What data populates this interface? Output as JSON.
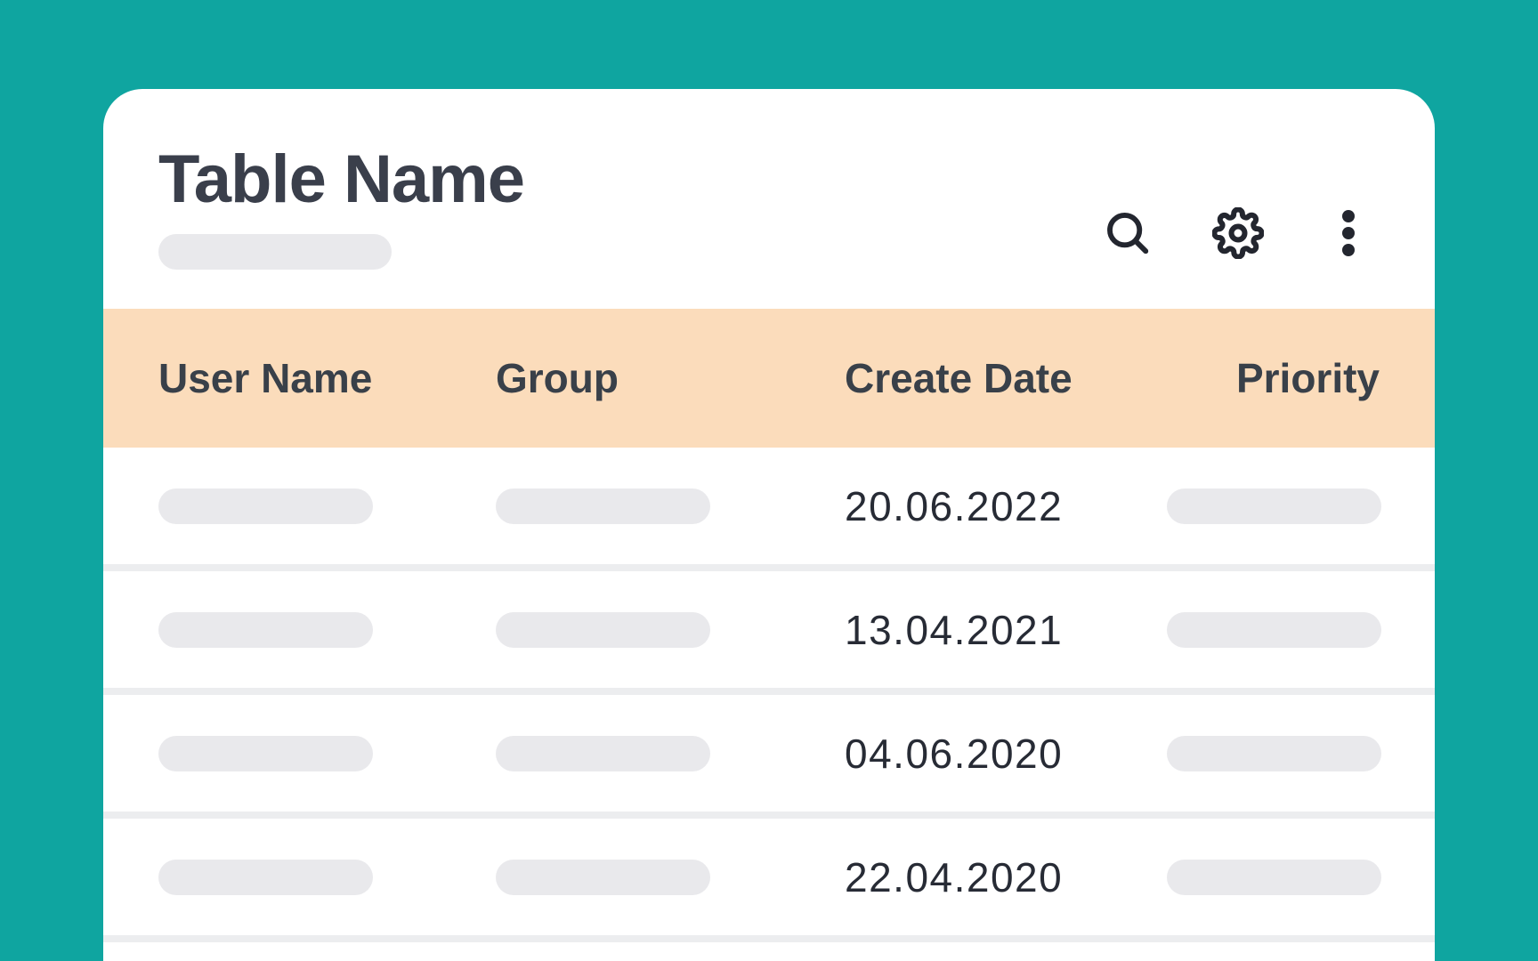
{
  "page": {
    "background_color": "#0FA5A0"
  },
  "card": {
    "title": "Table Name",
    "toolbar": {
      "icons": [
        "search-icon",
        "gear-icon",
        "kebab-menu-icon"
      ],
      "icon_color": "#23262F"
    },
    "table": {
      "header_bg_color": "#FBDCBB",
      "placeholder_color": "#E9E9EC",
      "columns": [
        "User Name",
        "Group",
        "Create Date",
        "Priority"
      ],
      "rows": [
        {
          "user_name": "",
          "group": "",
          "create_date": "20.06.2022",
          "priority": ""
        },
        {
          "user_name": "",
          "group": "",
          "create_date": "13.04.2021",
          "priority": ""
        },
        {
          "user_name": "",
          "group": "",
          "create_date": "04.06.2020",
          "priority": ""
        },
        {
          "user_name": "",
          "group": "",
          "create_date": "22.04.2020",
          "priority": ""
        }
      ]
    }
  }
}
